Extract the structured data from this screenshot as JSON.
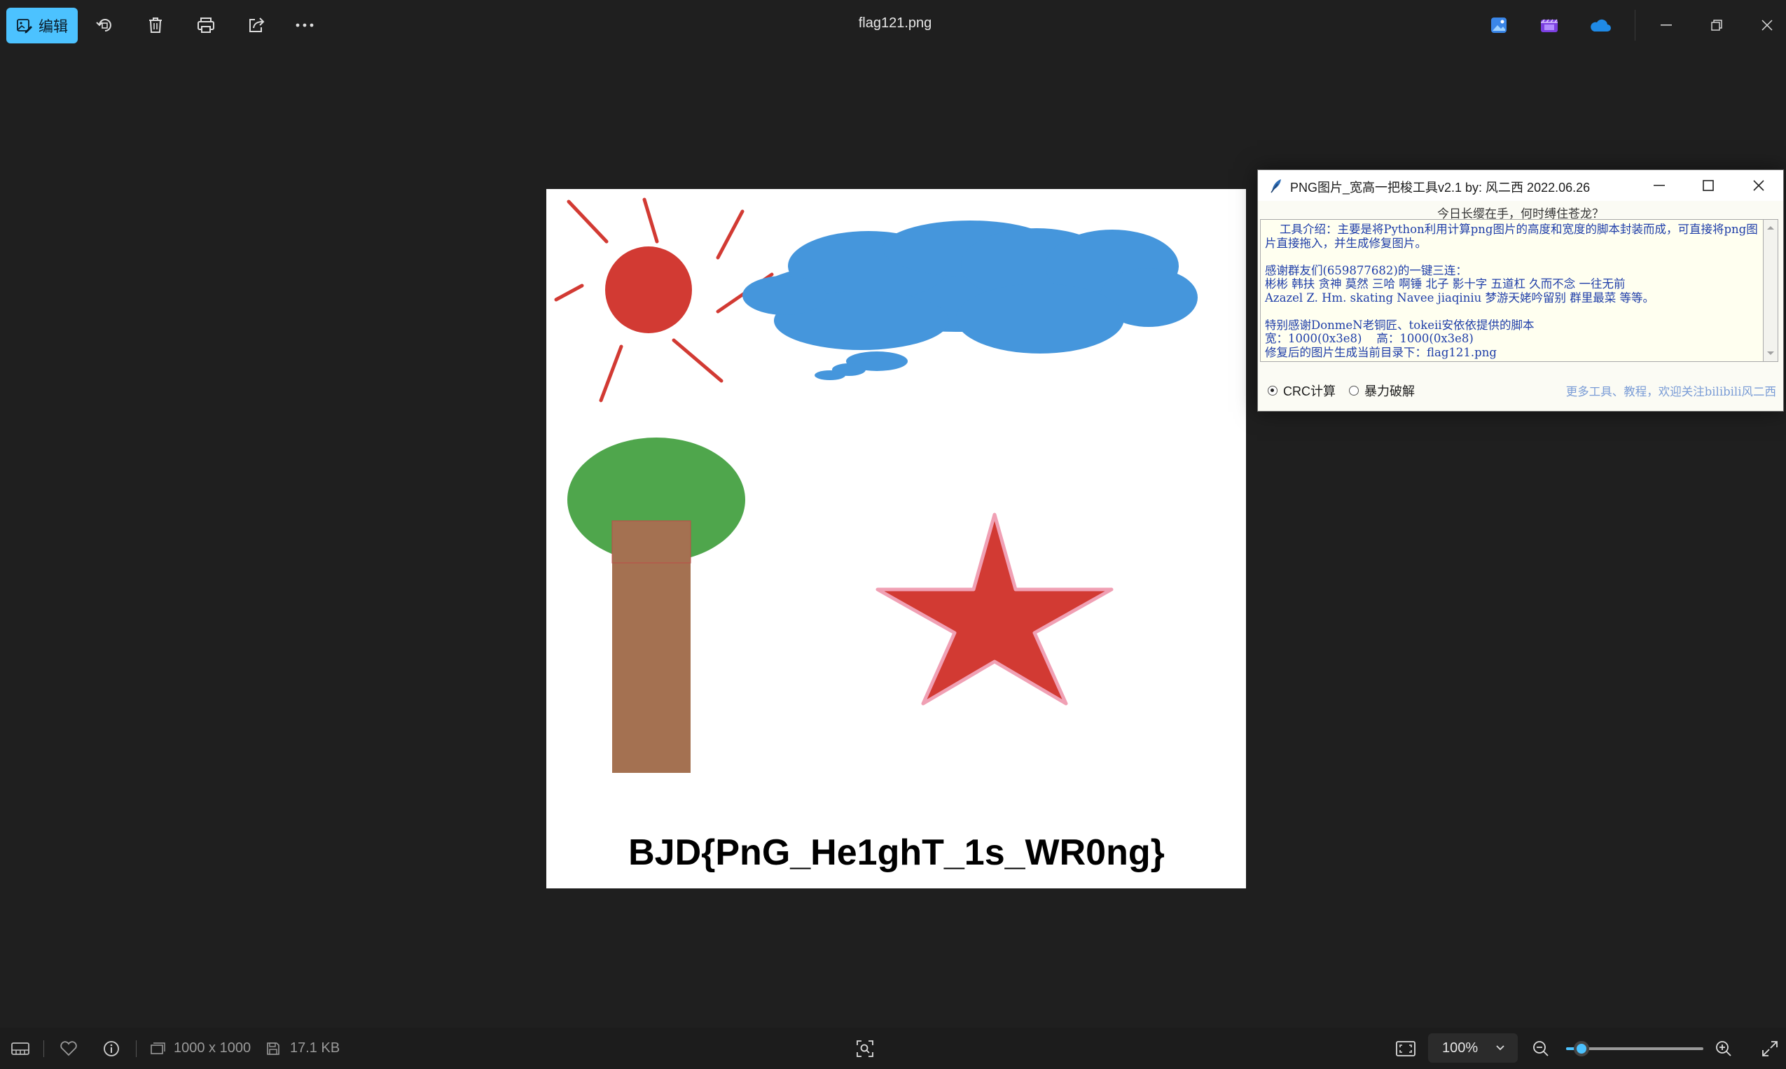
{
  "toolbar": {
    "edit_label": "编辑",
    "file_title": "flag121.png",
    "accent": "#4cc2ff"
  },
  "image": {
    "flag_text": "BJD{PnG_He1ghT_1s_WR0ng}",
    "colors": {
      "sun": "#d23a33",
      "cloud": "#4596dc",
      "leaves": "#4fa64c",
      "trunk": "#a47151",
      "star": "#d23a33",
      "star_outline": "#f0a0b4"
    }
  },
  "tool_window": {
    "title": "PNG图片_宽高一把梭工具v2.1   by: 风二西 2022.06.26",
    "motto": "今日长缨在手，何时缚住苍龙？",
    "intro": "    工具介绍：主要是将Python利用计算png图片的高度和宽度的脚本封装而成，可直接将png图片直接拖入，并生成修复图片。",
    "thanks_heading": "感谢群友们(659877682)的一键三连：",
    "thanks_names_1": "彬彬 韩扶 贪神 莫然 三哈 啊锤 北子 影十字 五道杠 久而不念 一往无前",
    "thanks_names_2": "Azazel Z. Hm. skating Navee jiaqiniu 梦游天姥吟留别 群里最菜 等等。",
    "special_thanks": "特别感谢DonmeN老铜匠、tokeii安依依提供的脚本",
    "dimensions": "宽：1000(0x3e8)    高：1000(0x3e8)",
    "output": "修复后的图片生成当前目录下：flag121.png",
    "radio_crc": "CRC计算",
    "radio_brute": "暴力破解",
    "promo": "更多工具、教程，欢迎关注bilibili风二西"
  },
  "statusbar": {
    "dimensions": "1000 x 1000",
    "file_size": "17.1 KB",
    "zoom": "100%",
    "zoom_slider_fraction": 0.11
  }
}
